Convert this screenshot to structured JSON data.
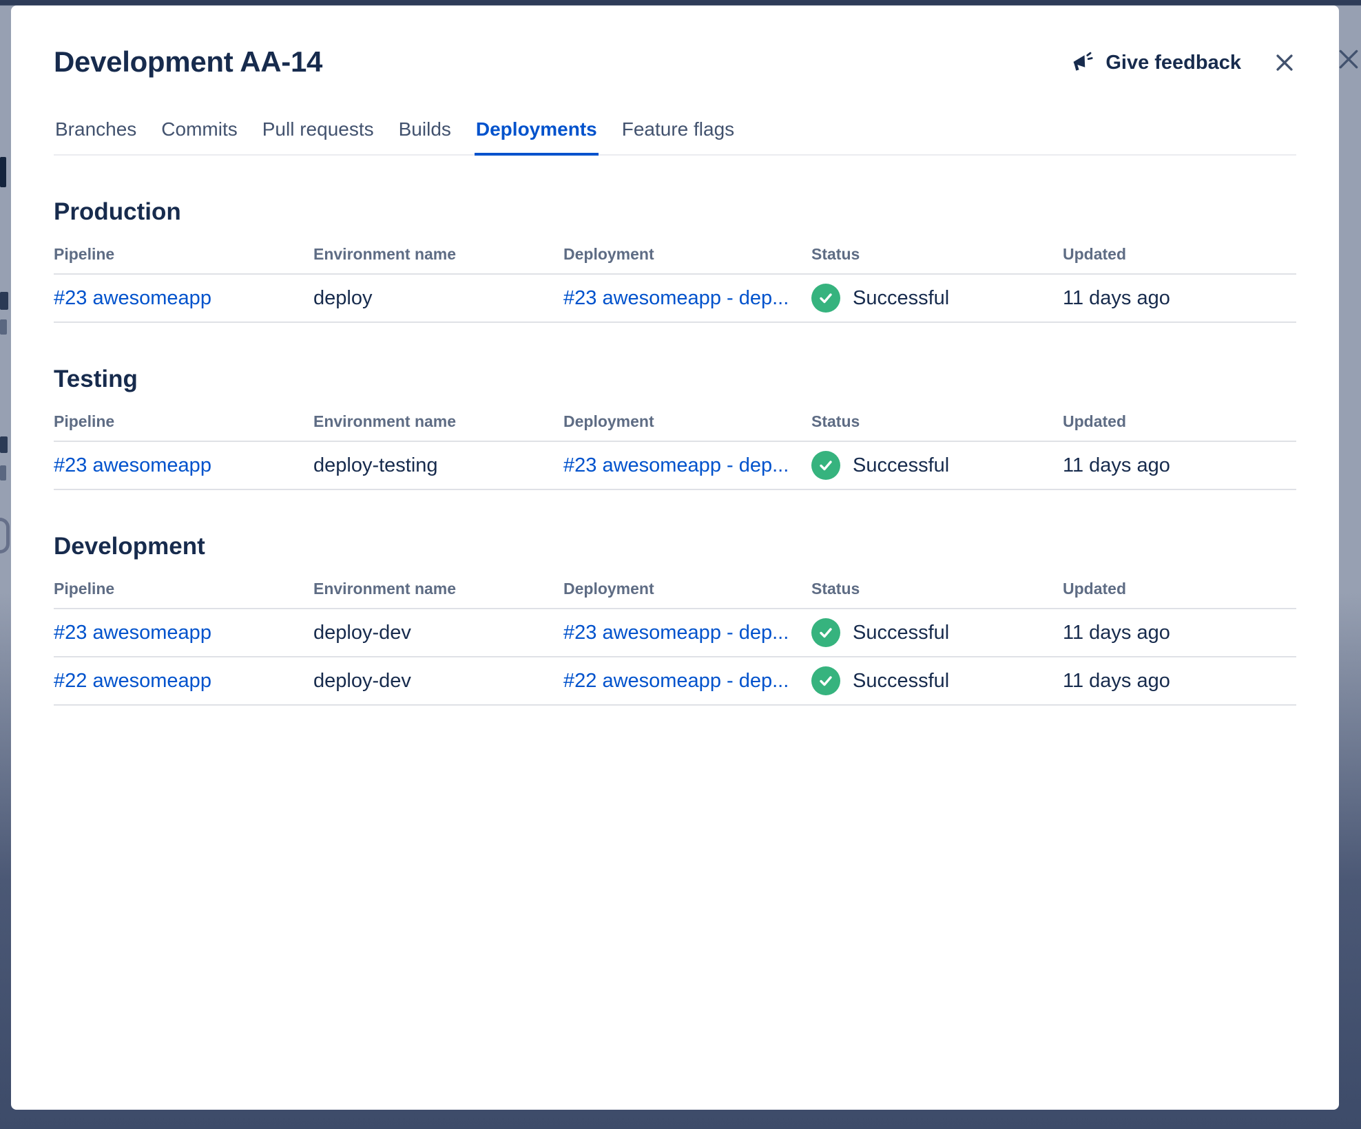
{
  "modal": {
    "title": "Development AA-14",
    "feedback_label": "Give feedback"
  },
  "tabs": [
    {
      "label": "Branches"
    },
    {
      "label": "Commits"
    },
    {
      "label": "Pull requests"
    },
    {
      "label": "Builds"
    },
    {
      "label": "Deployments",
      "active": true
    },
    {
      "label": "Feature flags"
    }
  ],
  "columns": [
    "Pipeline",
    "Environment name",
    "Deployment",
    "Status",
    "Updated"
  ],
  "sections": [
    {
      "title": "Production",
      "rows": [
        {
          "pipeline": "#23 awesomeapp",
          "environment": "deploy",
          "deployment": "#23 awesomeapp - dep...",
          "status": "Successful",
          "updated": "11 days ago"
        }
      ]
    },
    {
      "title": "Testing",
      "rows": [
        {
          "pipeline": "#23 awesomeapp",
          "environment": "deploy-testing",
          "deployment": "#23 awesomeapp - dep...",
          "status": "Successful",
          "updated": "11 days ago"
        }
      ]
    },
    {
      "title": "Development",
      "rows": [
        {
          "pipeline": "#23 awesomeapp",
          "environment": "deploy-dev",
          "deployment": "#23 awesomeapp - dep...",
          "status": "Successful",
          "updated": "11 days ago"
        },
        {
          "pipeline": "#22 awesomeapp",
          "environment": "deploy-dev",
          "deployment": "#22 awesomeapp - dep...",
          "status": "Successful",
          "updated": "11 days ago"
        }
      ]
    }
  ],
  "colors": {
    "accent": "#0052CC",
    "success_green": "#36B37E",
    "heading_text": "#172B4D"
  }
}
